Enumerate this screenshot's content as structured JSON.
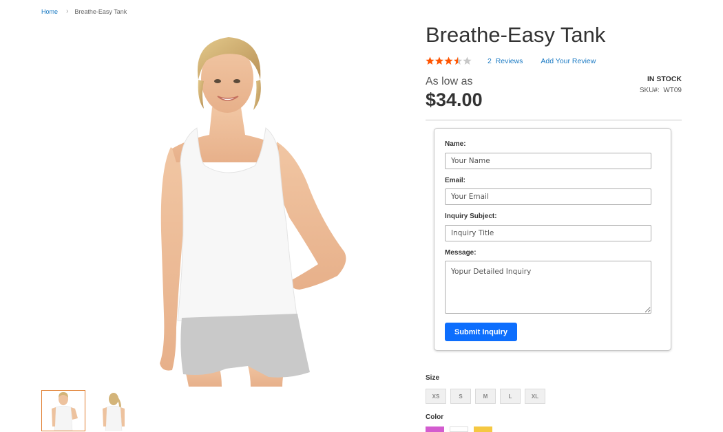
{
  "breadcrumb": {
    "home": "Home",
    "separator": "›",
    "current": "Breathe-Easy Tank"
  },
  "product": {
    "title": "Breathe-Easy Tank",
    "rating": 3.5,
    "rating_max": 5,
    "reviews_count": "2",
    "reviews_label": "Reviews",
    "add_review": "Add Your Review",
    "price_prefix": "As low as",
    "price": "$34.00",
    "stock": "IN STOCK",
    "sku_label": "SKU#:",
    "sku": "WT09"
  },
  "inquiry_form": {
    "name_label": "Name:",
    "name_placeholder": "Your Name",
    "email_label": "Email:",
    "email_placeholder": "Your Email",
    "subject_label": "Inquiry Subject:",
    "subject_placeholder": "Inquiry Title",
    "message_label": "Message:",
    "message_placeholder": "Yopur Detailed Inquiry",
    "submit": "Submit Inquiry"
  },
  "options": {
    "size_label": "Size",
    "sizes": [
      "XS",
      "S",
      "M",
      "L",
      "XL"
    ],
    "color_label": "Color",
    "colors": [
      "#d35ccf",
      "#ffffff",
      "#f5c842"
    ]
  },
  "gallery": {
    "thumbnails": [
      "front-view",
      "back-view"
    ],
    "active_thumbnail": 0
  },
  "colors": {
    "link": "#1979c3",
    "star": "#ff5501",
    "button": "#0d6efd",
    "thumb_active_border": "#e07b2b"
  }
}
